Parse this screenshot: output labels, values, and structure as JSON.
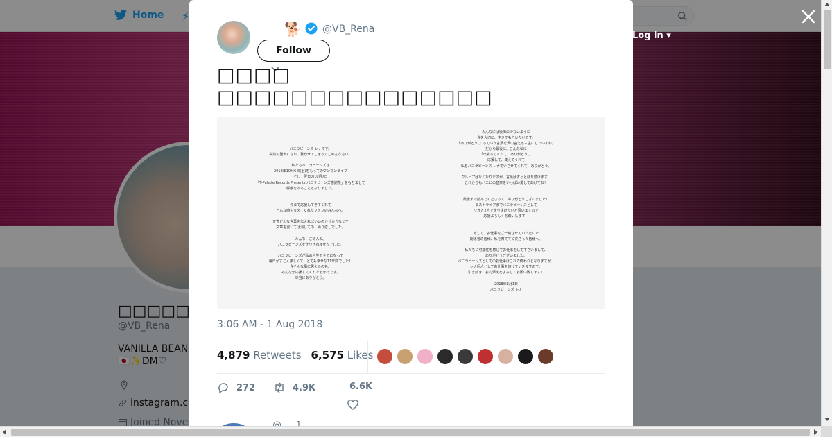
{
  "nav": {
    "home_label": "Home",
    "login_label": "Log in"
  },
  "profile": {
    "display_name": "□□□□□□□ □",
    "handle": "@VB_Rena",
    "bio_line1": "VANILLA BEANS",
    "bio_line2": "🇯🇵✨DM♡",
    "link": "instagram.c",
    "joined": "Joined Nove"
  },
  "tweet": {
    "handle": "@VB_Rena",
    "dog_emoji": "🐕",
    "follow_label": "Follow",
    "text_line1": "□□□□",
    "text_line2": "□□□□□□□□□□□□□□□",
    "timestamp": "3:06 AM - 1 Aug 2018",
    "retweets_count": "4,879",
    "retweets_label": "Retweets",
    "likes_count": "6,575",
    "likes_label": "Likes",
    "reply_count": "272",
    "retweet_count": "4.9K",
    "like_count": "6.6K",
    "reply_preview_handle": "@ ... 1"
  },
  "letter_left": [
    "バニラビーンズ レナです。",
    "突然の発表になり、驚かせてしまってごめんなさい。",
    "",
    "私たちバニラビーンズは",
    "2018年10月6日(土)をもってのワンマンライブ",
    "そして翌日の10月7日",
    "「T-Palette Records Presents バニラビーンズ感謝祭」をもちまして",
    "解散をすることとなりました。",
    "",
    "",
    "今まで応援してきてくれて",
    "どんな時も支えてくれたファンのみんなへ。",
    "",
    "正直どんな言葉を伝えればいいのか分からなくて",
    "文章を書いては消しての、繰り返しでした。",
    "",
    "みんな、ごめんね。",
    "バニラビーンズを守りきれませんでした。",
    "",
    "バニラビーンズが私の人生の全てになって",
    "毎日がすごく楽しくて、とても幸せな11年間でした！",
    "今そんな風に思えるのも、",
    "みんなが応援してくれたおかげです。",
    "本当にありがとう。"
  ],
  "letter_right": [
    "みんなには後悔の少ないように",
    "今を大切に、生きてもらいたいです。",
    "「ありがとう。」っていう言葉を沢山言える人生にしたいよね。",
    "だから最後に、こんな私に",
    "「出会ってくれて、ありがとう。」",
    "応援して、支えてくれて",
    "私をバニラビーンズ レナでいさせてくれて、ありがとう。",
    "",
    "グループはなくなりますが、言葉はずっと残り続けます。",
    "これからもバニビの音楽をいっぱい愛してあげてね！",
    "",
    "",
    "最後まで読んでくださって、ありがとうございました！",
    "ラストライブまでバニラビーンズとして",
    "リサと2人で走り抜けたいと思いますので",
    "応援よろしくお願いします！",
    "",
    "",
    "そして、お仕事をご一緒させていただいた",
    "関係者の皆様、私を育ててくださった皆様へ。",
    "",
    "私たちに可能性を感じてお仕事をして下さいまして、",
    "ありがとうございました。",
    "バニラビーンズとしてのお仕事はこれで終わりとなりますが、",
    "レナ個人としてお仕事を続けていきますので、",
    "引き続き、お力添えをよろしくお願い致します！",
    "",
    "2018年8月1日",
    "バニラビーンズ レナ"
  ],
  "liker_colors": [
    "#c44d3d",
    "#c9a070",
    "#f0b0c8",
    "#2a2a2a",
    "#3a3a3a",
    "#c03030",
    "#d8b0a0",
    "#1a1a1a",
    "#6a3a2a"
  ]
}
